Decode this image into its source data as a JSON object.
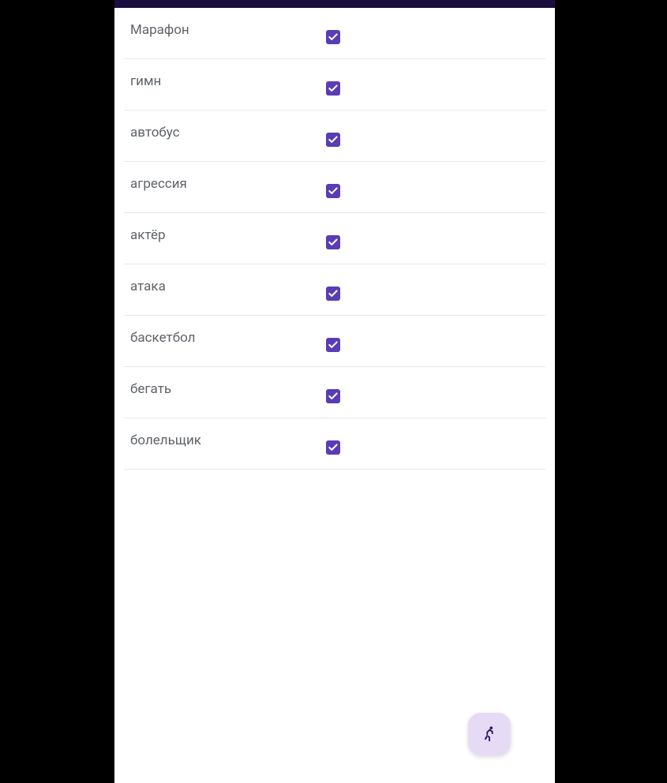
{
  "colors": {
    "accent": "#5a3cb5",
    "fab_bg": "#e6dbf5",
    "fab_icon": "#2d1b5c",
    "header": "#1a0e3e",
    "text": "#5f6368",
    "divider": "#e8e8e8"
  },
  "word_list": [
    {
      "label": "Марафон",
      "checked": true
    },
    {
      "label": "гимн",
      "checked": true
    },
    {
      "label": "автобус",
      "checked": true
    },
    {
      "label": "агрессия",
      "checked": true
    },
    {
      "label": "актёр",
      "checked": true
    },
    {
      "label": "атака",
      "checked": true
    },
    {
      "label": "баскетбол",
      "checked": true
    },
    {
      "label": "бегать",
      "checked": true
    },
    {
      "label": "болельщик",
      "checked": true
    }
  ],
  "fab": {
    "icon_name": "run-icon"
  }
}
